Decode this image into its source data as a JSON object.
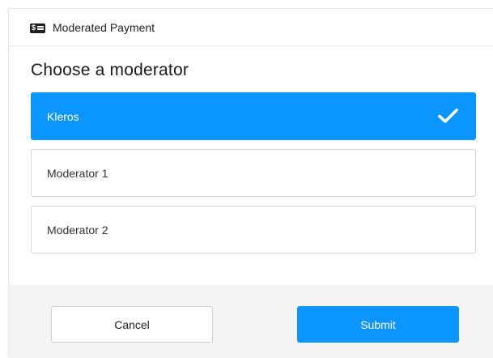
{
  "header": {
    "icon": "payment-card-icon",
    "title": "Moderated Payment"
  },
  "heading": "Choose a moderator",
  "moderators": [
    {
      "label": "Kleros",
      "selected": true
    },
    {
      "label": "Moderator 1",
      "selected": false
    },
    {
      "label": "Moderator 2",
      "selected": false
    }
  ],
  "selected_icon": "checkmark-icon",
  "buttons": {
    "cancel_label": "Cancel",
    "submit_label": "Submit"
  },
  "colors": {
    "accent": "#0a95ff",
    "footer_bg": "#f4f4f4"
  }
}
